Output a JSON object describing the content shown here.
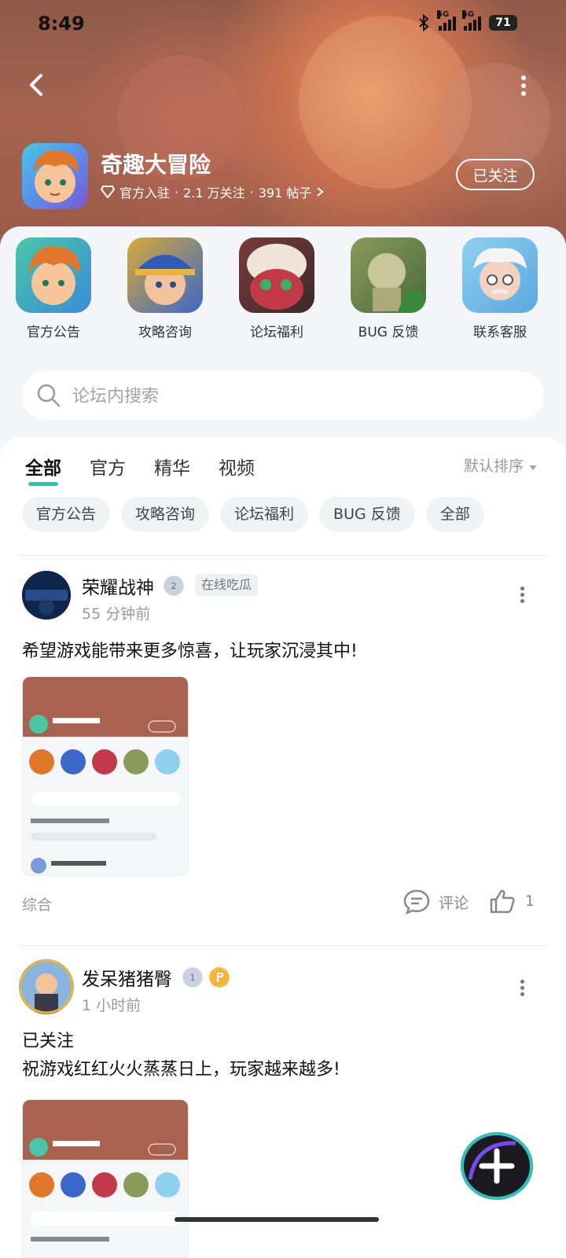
{
  "status_bar": {
    "time": "8:49",
    "network_1": "5G",
    "network_2": "5G",
    "battery": "71"
  },
  "header": {
    "game_title": "奇趣大冒险",
    "meta_official": "官方入驻",
    "meta_followers": "2.1 万关注",
    "meta_posts": "391 帖子",
    "meta_sep": "·",
    "follow_label": "已关注"
  },
  "categories": [
    {
      "label": "官方公告",
      "icon": "hero-boy-avatar"
    },
    {
      "label": "攻略咨询",
      "icon": "pirate-girl-avatar"
    },
    {
      "label": "论坛福利",
      "icon": "dino-skull-avatar"
    },
    {
      "label": "BUG 反馈",
      "icon": "goblin-avatar"
    },
    {
      "label": "联系客服",
      "icon": "professor-avatar"
    }
  ],
  "search": {
    "placeholder": "论坛内搜索"
  },
  "tabs": [
    "全部",
    "官方",
    "精华",
    "视频"
  ],
  "sort_label": "默认排序",
  "chips": [
    "官方公告",
    "攻略咨询",
    "论坛福利",
    "BUG 反馈",
    "全部"
  ],
  "posts": [
    {
      "author": "荣耀战神",
      "level_badge": "2",
      "tag": "在线吃瓜",
      "time": "55 分钟前",
      "text": "希望游戏能带来更多惊喜，让玩家沉浸其中!",
      "category": "综合",
      "comment_label": "评论",
      "likes": "1"
    },
    {
      "author": "发呆猪猪臀",
      "level_badge": "1",
      "time": "1 小时前",
      "text_1": "已关注",
      "text_2": "祝游戏红红火火蒸蒸日上，玩家越来越多!"
    }
  ],
  "colors": {
    "accent": "#1ec9b6",
    "header_bg": "#9b5b49",
    "sheet_bg": "#f3f5f8"
  }
}
